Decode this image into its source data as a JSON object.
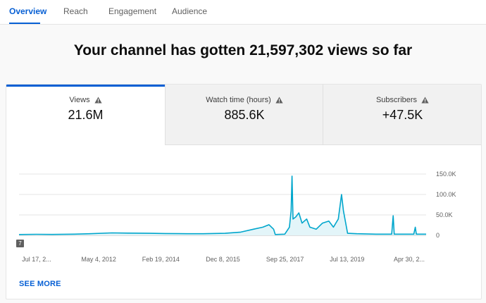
{
  "tabs": [
    {
      "label": "Overview",
      "active": true
    },
    {
      "label": "Reach",
      "active": false
    },
    {
      "label": "Engagement",
      "active": false
    },
    {
      "label": "Audience",
      "active": false
    }
  ],
  "headline": "Your channel has gotten 21,597,302 views so far",
  "metrics": [
    {
      "label": "Views",
      "value": "21.6M",
      "icon": "warning-icon"
    },
    {
      "label": "Watch time (hours)",
      "value": "885.6K",
      "icon": "warning-icon"
    },
    {
      "label": "Subscribers",
      "value": "+47.5K",
      "icon": "warning-icon"
    }
  ],
  "badge": "7",
  "see_more": "SEE MORE",
  "colors": {
    "accent": "#065fd4",
    "line": "#00a6cc",
    "fill": "#e3f5f9"
  },
  "chart_data": {
    "type": "area",
    "title": "",
    "xlabel": "",
    "ylabel": "",
    "ylim": [
      0,
      150000
    ],
    "yticks": [
      "150.0K",
      "100.0K",
      "50.0K",
      "0"
    ],
    "ytick_values": [
      150000,
      100000,
      50000,
      0
    ],
    "xticks": [
      "Jul 17, 2...",
      "May 4, 2012",
      "Feb 19, 2014",
      "Dec 8, 2015",
      "Sep 25, 2017",
      "Jul 13, 2019",
      "Apr 30, 2..."
    ],
    "x_domain": [
      "2010-07-17",
      "2021-04-30"
    ],
    "grid": true,
    "series": [
      {
        "values": [
          [
            "2010-07-17",
            2000
          ],
          [
            "2011-01-01",
            2500
          ],
          [
            "2011-06-01",
            2200
          ],
          [
            "2012-01-01",
            3000
          ],
          [
            "2012-06-01",
            4000
          ],
          [
            "2013-01-01",
            6000
          ],
          [
            "2013-06-01",
            5500
          ],
          [
            "2014-01-01",
            5000
          ],
          [
            "2014-06-01",
            4500
          ],
          [
            "2015-01-01",
            4000
          ],
          [
            "2015-06-01",
            4000
          ],
          [
            "2016-01-01",
            5000
          ],
          [
            "2016-06-01",
            8000
          ],
          [
            "2016-10-01",
            15000
          ],
          [
            "2017-01-01",
            20000
          ],
          [
            "2017-03-01",
            26000
          ],
          [
            "2017-04-15",
            15000
          ],
          [
            "2017-05-01",
            2000
          ],
          [
            "2017-08-01",
            3000
          ],
          [
            "2017-09-15",
            20000
          ],
          [
            "2017-10-01",
            60000
          ],
          [
            "2017-10-10",
            145000
          ],
          [
            "2017-10-20",
            40000
          ],
          [
            "2017-11-15",
            45000
          ],
          [
            "2017-12-15",
            55000
          ],
          [
            "2018-01-15",
            30000
          ],
          [
            "2018-03-01",
            40000
          ],
          [
            "2018-04-01",
            20000
          ],
          [
            "2018-06-01",
            15000
          ],
          [
            "2018-08-01",
            30000
          ],
          [
            "2018-10-01",
            35000
          ],
          [
            "2018-11-15",
            20000
          ],
          [
            "2019-01-01",
            40000
          ],
          [
            "2019-02-01",
            100000
          ],
          [
            "2019-02-20",
            60000
          ],
          [
            "2019-04-01",
            5000
          ],
          [
            "2019-07-01",
            4000
          ],
          [
            "2020-01-01",
            3000
          ],
          [
            "2020-06-01",
            3000
          ],
          [
            "2020-06-15",
            48000
          ],
          [
            "2020-06-25",
            3000
          ],
          [
            "2021-01-01",
            3000
          ],
          [
            "2021-01-15",
            20000
          ],
          [
            "2021-01-25",
            3000
          ],
          [
            "2021-04-30",
            3000
          ]
        ]
      }
    ]
  }
}
